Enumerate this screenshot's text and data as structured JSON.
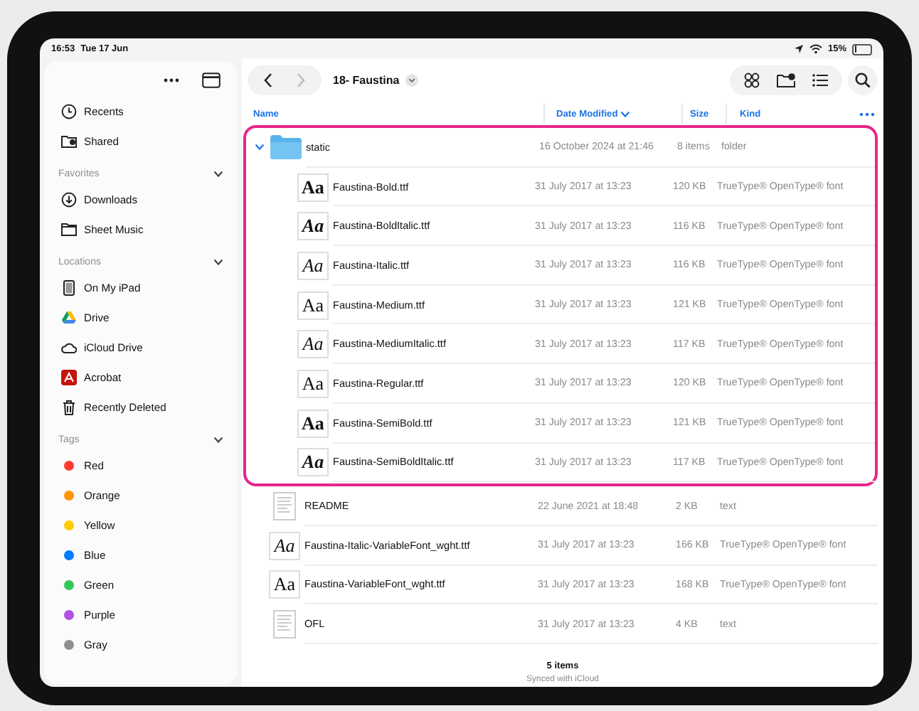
{
  "status_bar": {
    "time": "16:53",
    "date": "Tue 17 Jun",
    "battery": "15%"
  },
  "sidebar": {
    "top_items": [
      {
        "label": "Recents",
        "kind": "recents",
        "selected": false
      },
      {
        "label": "Shared",
        "kind": "shared",
        "selected": false
      }
    ],
    "sections": [
      {
        "title": "Favorites",
        "expanded": true,
        "items": [
          {
            "label": "Downloads",
            "kind": "download",
            "selected": false
          },
          {
            "label": "Sheet Music",
            "kind": "folder",
            "selected": false
          }
        ]
      },
      {
        "title": "Locations",
        "expanded": true,
        "items": [
          {
            "label": "On My iPad",
            "kind": "device",
            "selected": false
          },
          {
            "label": "Drive",
            "kind": "drive",
            "selected": false
          },
          {
            "label": "iCloud Drive",
            "kind": "cloud",
            "selected": false
          },
          {
            "label": "Acrobat",
            "kind": "acrobat",
            "selected": false
          },
          {
            "label": "Recently Deleted",
            "kind": "trash",
            "selected": false
          }
        ]
      },
      {
        "title": "Tags",
        "expanded": true,
        "items": [
          {
            "label": "Red",
            "kind": "tag",
            "color": "#ff3b30",
            "selected": false
          },
          {
            "label": "Orange",
            "kind": "tag",
            "color": "#ff9500",
            "selected": false
          },
          {
            "label": "Yellow",
            "kind": "tag",
            "color": "#ffcc00",
            "selected": false
          },
          {
            "label": "Blue",
            "kind": "tag",
            "color": "#007aff",
            "selected": false
          },
          {
            "label": "Green",
            "kind": "tag",
            "color": "#34c759",
            "selected": false
          },
          {
            "label": "Purple",
            "kind": "tag",
            "color": "#af52de",
            "selected": false
          },
          {
            "label": "Gray",
            "kind": "tag",
            "color": "#8e8e93",
            "selected": false
          }
        ]
      }
    ]
  },
  "toolbar": {
    "title": "18- Faustina",
    "back_enabled": true,
    "forward_enabled": false
  },
  "columns": [
    {
      "label": "Name",
      "sorted": false
    },
    {
      "label": "Date Modified",
      "sorted": true
    },
    {
      "label": "Size",
      "sorted": false
    },
    {
      "label": "Kind",
      "sorted": false
    }
  ],
  "files": [
    {
      "name": "static",
      "kind": "folder",
      "date": "16 October 2024 at 21:46",
      "size": "8 items",
      "type": "folder",
      "expanded": true,
      "highlighted": true,
      "children": [
        {
          "name": "Faustina-Bold.ttf",
          "kind": "font",
          "preview": "Aa",
          "bold": true,
          "italic": false,
          "date": "31 July 2017 at 13:23",
          "size": "120 KB",
          "type": "TrueType® OpenType® font"
        },
        {
          "name": "Faustina-BoldItalic.ttf",
          "kind": "font",
          "preview": "Aa",
          "bold": true,
          "italic": true,
          "date": "31 July 2017 at 13:23",
          "size": "116 KB",
          "type": "TrueType® OpenType® font"
        },
        {
          "name": "Faustina-Italic.ttf",
          "kind": "font",
          "preview": "Aa",
          "bold": false,
          "italic": true,
          "date": "31 July 2017 at 13:23",
          "size": "116 KB",
          "type": "TrueType® OpenType® font"
        },
        {
          "name": "Faustina-Medium.ttf",
          "kind": "font",
          "preview": "Aa",
          "bold": false,
          "italic": false,
          "date": "31 July 2017 at 13:23",
          "size": "121 KB",
          "type": "TrueType® OpenType® font"
        },
        {
          "name": "Faustina-MediumItalic.ttf",
          "kind": "font",
          "preview": "Aa",
          "bold": false,
          "italic": true,
          "date": "31 July 2017 at 13:23",
          "size": "117 KB",
          "type": "TrueType® OpenType® font"
        },
        {
          "name": "Faustina-Regular.ttf",
          "kind": "font",
          "preview": "Aa",
          "bold": false,
          "italic": false,
          "date": "31 July 2017 at 13:23",
          "size": "120 KB",
          "type": "TrueType® OpenType® font"
        },
        {
          "name": "Faustina-SemiBold.ttf",
          "kind": "font",
          "preview": "Aa",
          "bold": true,
          "italic": false,
          "date": "31 July 2017 at 13:23",
          "size": "121 KB",
          "type": "TrueType® OpenType® font"
        },
        {
          "name": "Faustina-SemiBoldItalic.ttf",
          "kind": "font",
          "preview": "Aa",
          "bold": true,
          "italic": true,
          "date": "31 July 2017 at 13:23",
          "size": "117 KB",
          "type": "TrueType® OpenType® font"
        }
      ]
    },
    {
      "name": "README",
      "kind": "text",
      "date": "22 June 2021 at 18:48",
      "size": "2 KB",
      "type": "text"
    },
    {
      "name": "Faustina-Italic-VariableFont_wght.ttf",
      "kind": "font",
      "preview": "Aa",
      "bold": false,
      "italic": true,
      "date": "31 July 2017 at 13:23",
      "size": "166 KB",
      "type": "TrueType® OpenType® font"
    },
    {
      "name": "Faustina-VariableFont_wght.ttf",
      "kind": "font",
      "preview": "Aa",
      "bold": false,
      "italic": false,
      "date": "31 July 2017 at 13:23",
      "size": "168 KB",
      "type": "TrueType® OpenType® font"
    },
    {
      "name": "OFL",
      "kind": "text",
      "date": "31 July 2017 at 13:23",
      "size": "4 KB",
      "type": "text"
    }
  ],
  "footer": {
    "count": "5 items",
    "sync": "Synced with iCloud"
  }
}
